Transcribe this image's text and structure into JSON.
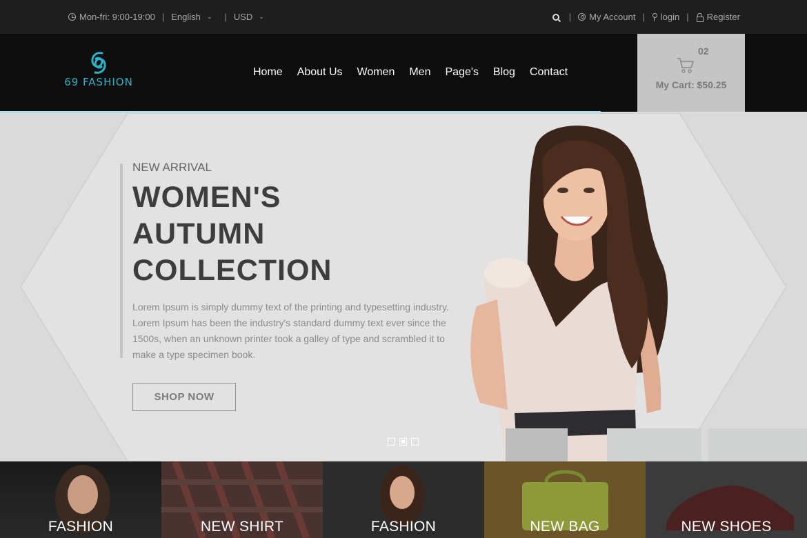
{
  "topbar": {
    "hours": "Mon-fri: 9:00-19:00",
    "language": "English",
    "currency": "USD",
    "my_account": "My Account",
    "login": "login",
    "register": "Register"
  },
  "header": {
    "logo_text": "69 FASHION",
    "nav": [
      "Home",
      "About Us",
      "Women",
      "Men",
      "Page's",
      "Blog",
      "Contact"
    ],
    "cart": {
      "count": "02",
      "total": "My Cart: $50.25"
    }
  },
  "hero": {
    "kicker": "NEW ARRIVAL",
    "headline": [
      "WOMEN'S",
      "AUTUMN",
      "COLLECTION"
    ],
    "description": "Lorem Ipsum is simply dummy text of the printing and typesetting industry. Lorem Ipsum has been the industry's standard dummy text ever since the 1500s, when an unknown printer took a galley of type and scrambled it to make a type specimen book.",
    "button": "SHOP NOW",
    "slider_dots": 3,
    "active_dot": 2
  },
  "categories": [
    {
      "label": "FASHION"
    },
    {
      "label": "NEW SHIRT"
    },
    {
      "label": "FASHION"
    },
    {
      "label": "NEW BAG"
    },
    {
      "label": "NEW SHOES"
    }
  ],
  "colors": {
    "accent": "#28b4c6",
    "topbar": "#1e1e1e",
    "header": "#0e0e0e",
    "cart_bg": "#c5c5c5"
  }
}
